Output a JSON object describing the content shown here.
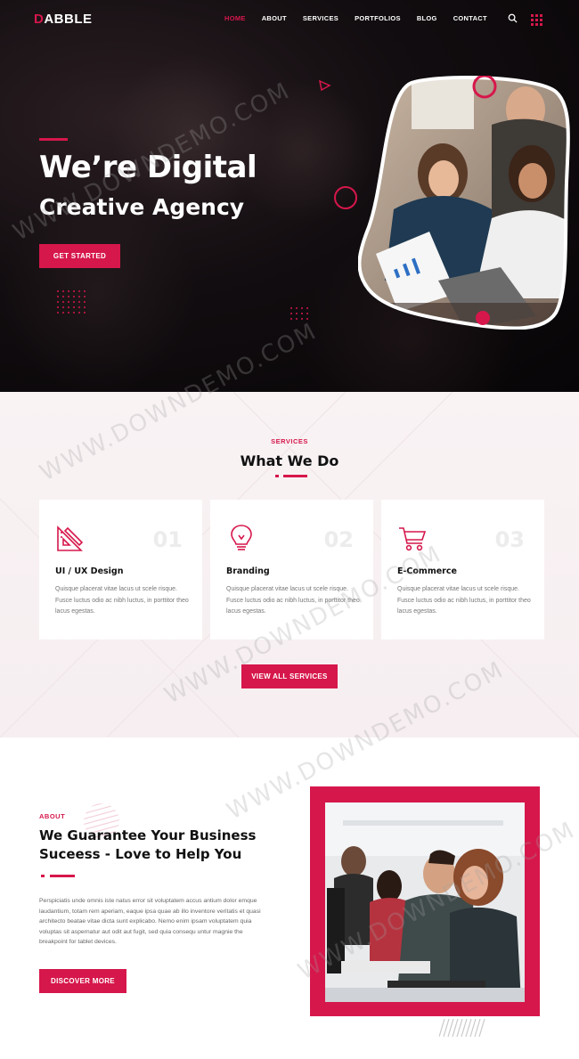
{
  "nav": {
    "logo": "DABBLE",
    "items": [
      {
        "label": "HOME",
        "active": true
      },
      {
        "label": "ABOUT",
        "active": false
      },
      {
        "label": "SERVICES",
        "active": false
      },
      {
        "label": "PORTFOLIOS",
        "active": false
      },
      {
        "label": "BLOG",
        "active": false
      },
      {
        "label": "CONTACT",
        "active": false
      }
    ],
    "icons": [
      "search-icon",
      "grid-menu-icon"
    ]
  },
  "hero": {
    "title_line_1": "We’re Digital",
    "title_line_2": "Creative Agency",
    "button_label": "GET STARTED"
  },
  "services": {
    "eyebrow": "SERVICES",
    "title": "What We Do",
    "cards": [
      {
        "icon": "design-tools-icon",
        "number": "01",
        "title": "UI / UX Design",
        "text": "Quisque placerat vitae lacus ut scele risque. Fusce luctus odio ac nibh luctus, in porttitor theo lacus egestas."
      },
      {
        "icon": "lightbulb-icon",
        "number": "02",
        "title": "Branding",
        "text": "Quisque placerat vitae lacus ut scele risque. Fusce luctus odio ac nibh luctus, in porttitor theo lacus egestas."
      },
      {
        "icon": "shopping-cart-icon",
        "number": "03",
        "title": "E-Commerce",
        "text": "Quisque placerat vitae lacus ut scele risque. Fusce luctus odio ac nibh luctus, in porttitor theo lacus egestas."
      }
    ],
    "button_label": "VIEW ALL SERVICES"
  },
  "about": {
    "eyebrow": "ABOUT",
    "title": "We Guarantee Your Business Suceess - Love to Help You",
    "paragraph": "Perspiciatis unde omnis iste natus error sit voluptatem accus antium dolor emque laudantium, totam rem aperiam, eaque ipsa quae ab illo inventore veritatis et quasi architecto beatae vitae dicta sunt explicabo. Nemo enim ipsam voluptatem quia voluptas sit aspernatur aut odit aut fugit, sed quia consequ untur magnie the breakpoint for tablet devices.",
    "button_label": "DISCOVER MORE"
  },
  "watermark": "WWW.DOWNDEMO.COM",
  "colors": {
    "accent": "#d6174b",
    "hero_background": "#0d0a0c",
    "services_background": "#f8f1f3",
    "card_number": "#ececec"
  }
}
